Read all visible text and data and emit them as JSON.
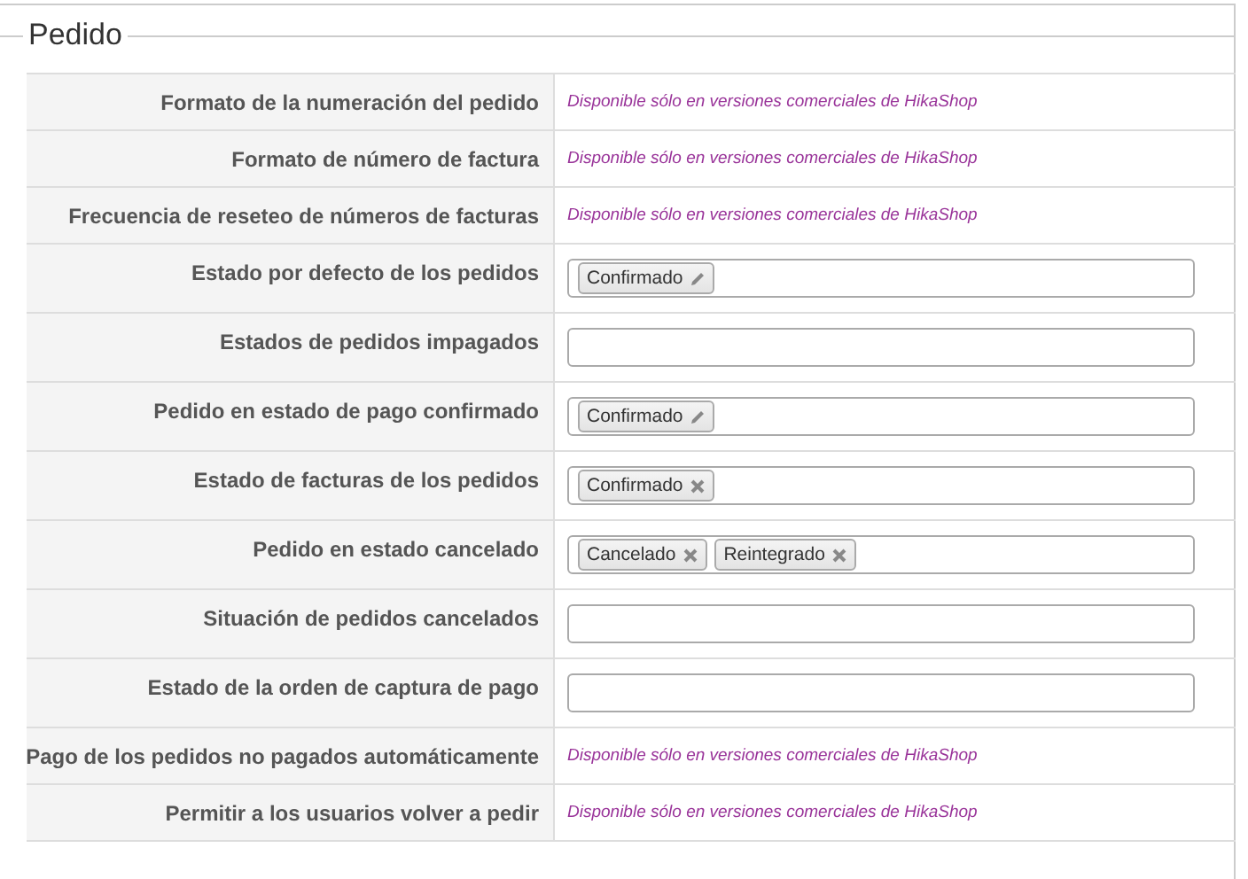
{
  "section": {
    "title": "Pedido"
  },
  "rows": [
    {
      "label": "Formato de la numeración del pedido",
      "kind": "note",
      "note": "Disponible sólo en versiones comerciales de HikaShop"
    },
    {
      "label": "Formato de número de factura",
      "kind": "note",
      "note": "Disponible sólo en versiones comerciales de HikaShop"
    },
    {
      "label": "Frecuencia de reseteo de números de facturas",
      "kind": "note",
      "note": "Disponible sólo en versiones comerciales de HikaShop"
    },
    {
      "label": "Estado por defecto de los pedidos",
      "kind": "tags",
      "tags": [
        {
          "text": "Confirmado",
          "kind": "edit"
        }
      ]
    },
    {
      "label": "Estados de pedidos impagados",
      "kind": "tags"
    },
    {
      "label": "Pedido en estado de pago confirmado",
      "kind": "tags",
      "tags": [
        {
          "text": "Confirmado",
          "kind": "edit"
        }
      ]
    },
    {
      "label": "Estado de facturas de los pedidos",
      "kind": "tags",
      "tags": [
        {
          "text": "Confirmado",
          "kind": "remove"
        }
      ]
    },
    {
      "label": "Pedido en estado cancelado",
      "kind": "tags",
      "tags": [
        {
          "text": "Cancelado",
          "kind": "remove"
        },
        {
          "text": "Reintegrado",
          "kind": "remove"
        }
      ]
    },
    {
      "label": "Situación de pedidos cancelados",
      "kind": "tags"
    },
    {
      "label": "Estado de la orden de captura de pago",
      "kind": "tags"
    },
    {
      "label": "Pago de los pedidos no pagados automáticamente",
      "kind": "note",
      "note": "Disponible sólo en versiones comerciales de HikaShop"
    },
    {
      "label": "Permitir a los usuarios volver a pedir",
      "kind": "note",
      "note": "Disponible sólo en versiones comerciales de HikaShop"
    }
  ]
}
